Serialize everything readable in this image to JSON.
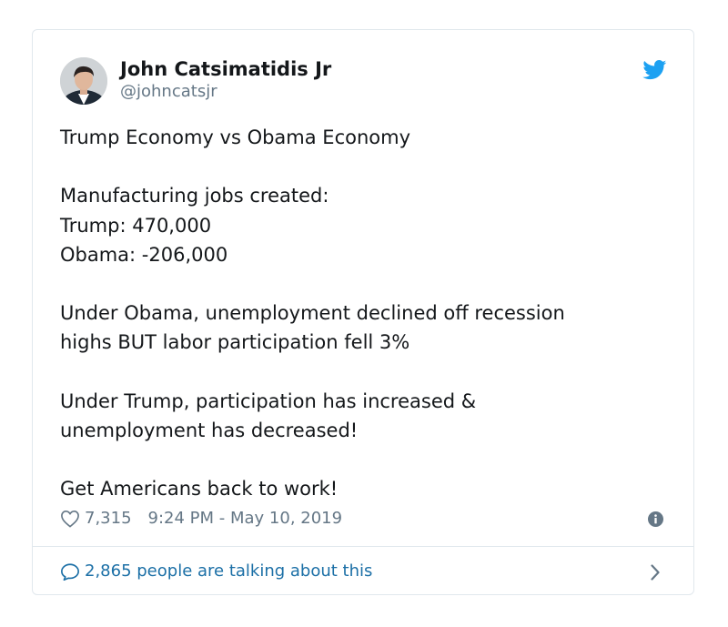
{
  "author": {
    "name": "John Catsimatidis Jr",
    "handle": "@johncatsjr",
    "avatar_icon": "profile-photo"
  },
  "tweet": {
    "paragraphs": [
      [
        "Trump Economy vs Obama Economy"
      ],
      [
        "Manufacturing jobs created:",
        "Trump: 470,000",
        "Obama: -206,000"
      ],
      [
        "Under Obama, unemployment declined off recession",
        "highs BUT labor participation fell 3%"
      ],
      [
        "Under Trump, participation has increased &",
        "unemployment has decreased!"
      ],
      [
        "Get Americans back to work!"
      ]
    ]
  },
  "meta": {
    "likes": "7,315",
    "timestamp": "9:24 PM - May 10, 2019",
    "heart_icon": "heart-outline",
    "info_icon": "info-circle"
  },
  "footer": {
    "talking": "2,865 people are talking about this",
    "bubble_icon": "speech-bubble",
    "chevron_icon": "chevron-right"
  },
  "colors": {
    "text": "#14171a",
    "secondary": "#657786",
    "link": "#1b6fa6",
    "twitter_blue": "#1da1f2",
    "border": "#e1e8ed"
  }
}
